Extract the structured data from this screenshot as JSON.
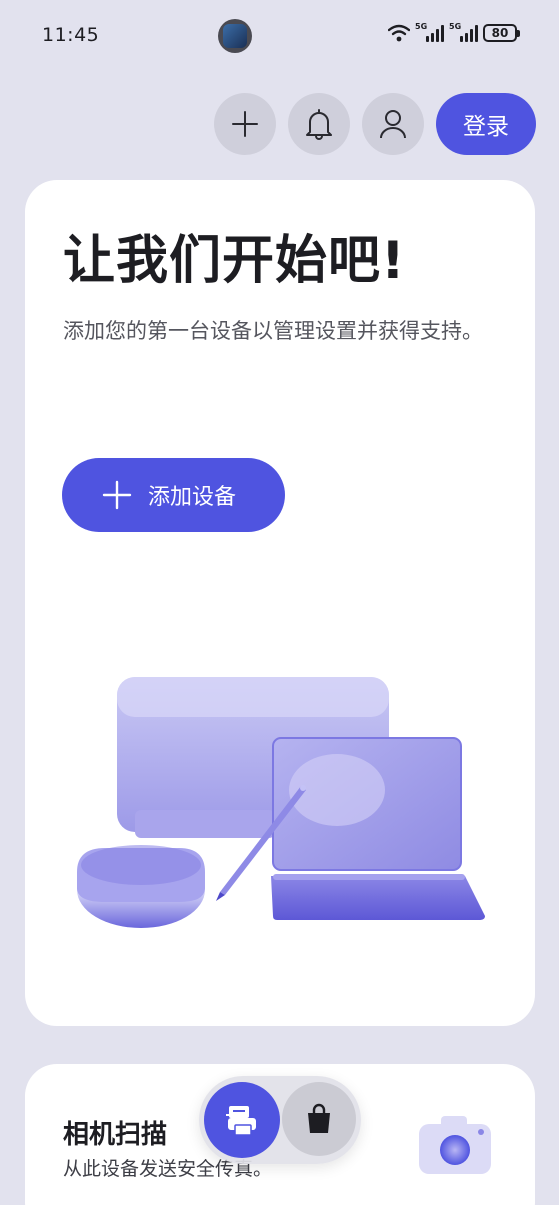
{
  "status_bar": {
    "time": "11:45",
    "signal1_label": "5G",
    "signal2_label": "5G",
    "battery": "80"
  },
  "top_actions": {
    "login_label": "登录",
    "icons": [
      "plus-icon",
      "bell-icon",
      "user-icon"
    ]
  },
  "main_card": {
    "headline": "让我们开始吧!",
    "subtext": "添加您的第一台设备以管理设置并获得支持。",
    "add_device_label": "添加设备"
  },
  "camera_scan": {
    "title": "相机扫描",
    "subtitle": "从此设备发送安全传真。"
  },
  "floating_bar": {
    "icons": [
      "printer-icon",
      "shopping-bag-icon"
    ]
  },
  "colors": {
    "accent": "#4f54e0",
    "background": "#e2e2ee",
    "card": "#ffffff"
  }
}
